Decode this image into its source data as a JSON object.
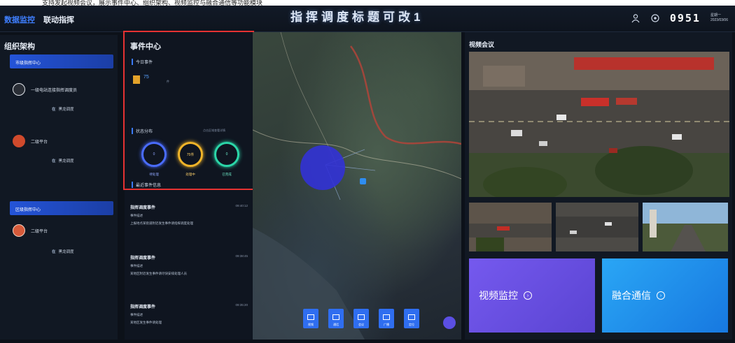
{
  "header": {
    "tab_active": "数据监控",
    "tab_other": "联动指挥",
    "title": "指挥调度标题可改1",
    "clock": "0951",
    "date_line1": "星期一",
    "date_line2": "2023/03/06"
  },
  "sidebar": {
    "title": "组织架构",
    "groups": [
      {
        "label": "市级指挥中心"
      },
      {
        "label": "区级指挥中心"
      }
    ],
    "people": [
      {
        "name": "一级电站连接指挥调度员",
        "sub_key": "在",
        "sub_value": "黑龙调度"
      },
      {
        "name": "二级平台",
        "sub_key": "在",
        "sub_value": "黑龙调度"
      },
      {
        "name": "二级平台",
        "sub_key": "在",
        "sub_value": "黑龙调度"
      }
    ]
  },
  "event_center": {
    "title": "事件中心",
    "section_today": "今日事件",
    "today_count": "75",
    "today_unit": "件",
    "section_status": "状态分布",
    "status_note": "点击区域查看详情",
    "status_rings": [
      {
        "value": "0",
        "label": "待处理",
        "color": "#4a6cff"
      },
      {
        "value": "75件",
        "label": "处理中",
        "color": "#f0b429"
      },
      {
        "value": "0",
        "label": "已完成",
        "color": "#2bd6a8"
      }
    ],
    "section_recent": "最近事件信息",
    "events": [
      {
        "title": "指挥调度事件",
        "time": "09:40:12",
        "line1": "事件描述",
        "line2": "上报地点某街道附近发生事件请指挥调度处理"
      },
      {
        "title": "指挥调度事件",
        "time": "09:38:45",
        "line1": "事件描述",
        "line2": "某地区附近发生事件请尽快安排处理人员"
      },
      {
        "title": "指挥调度事件",
        "time": "09:35:20",
        "line1": "事件描述",
        "line2": "某地区发生事件请处理"
      }
    ]
  },
  "map": {
    "dock": [
      {
        "label": "视频"
      },
      {
        "label": "通话"
      },
      {
        "label": "会议"
      },
      {
        "label": "广播"
      },
      {
        "label": "定位"
      }
    ]
  },
  "video": {
    "title": "视频会议",
    "btn_monitor": "视频监控",
    "btn_comm": "融合通信",
    "btn_monitor_color": "#6a4fe0",
    "btn_comm_color": "#1f8ff0"
  },
  "caption_text": "支持发起视频会议，展示事件中心、组织架构、视频监控与融合通信等功能模块"
}
